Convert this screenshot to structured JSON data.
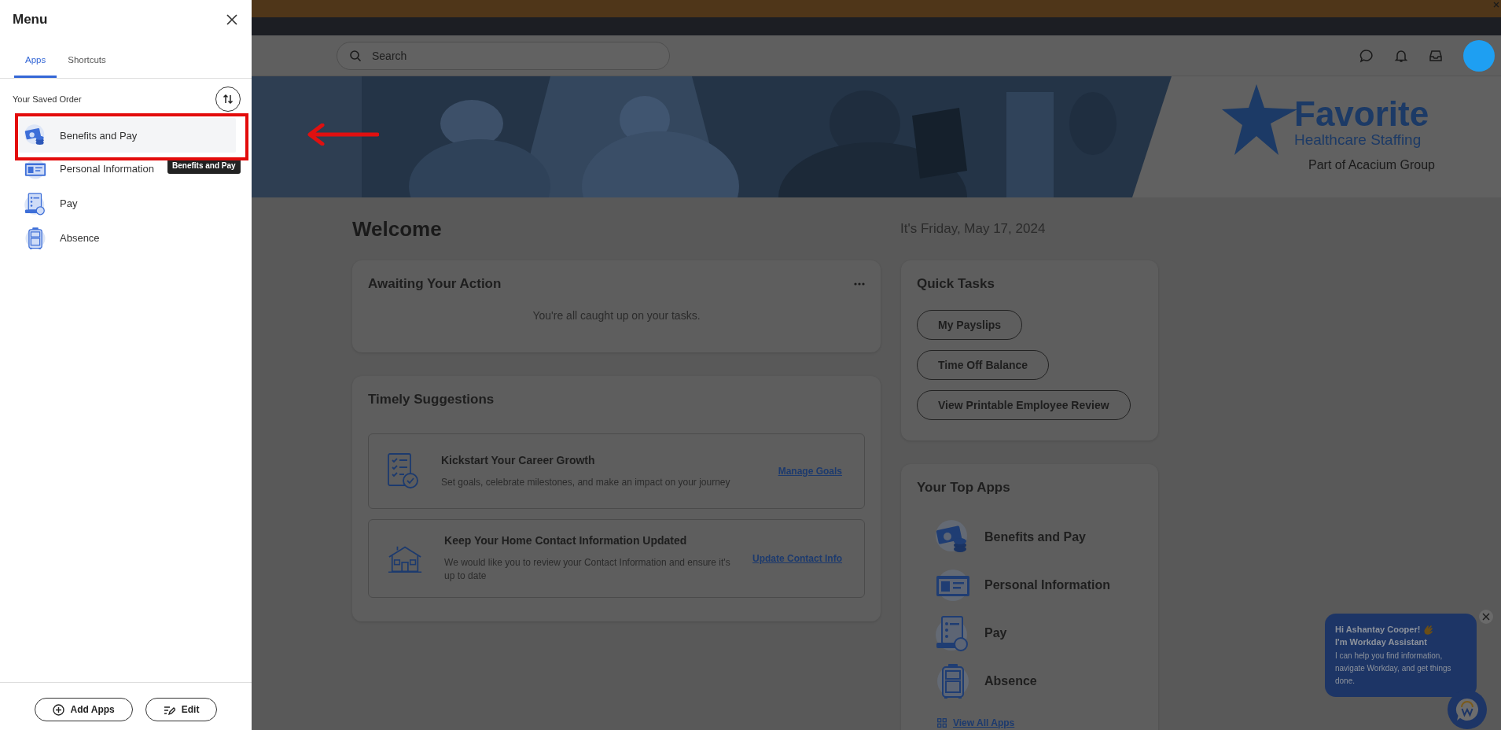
{
  "menu": {
    "title": "Menu",
    "tabs": [
      {
        "label": "Apps",
        "selected": true
      },
      {
        "label": "Shortcuts",
        "selected": false
      }
    ],
    "section_label": "Your Saved Order",
    "apps": [
      {
        "kind": "benefits",
        "label": "Benefits and Pay",
        "selected": true
      },
      {
        "kind": "personal",
        "label": "Personal Information",
        "selected": false
      },
      {
        "kind": "pay",
        "label": "Pay",
        "selected": false
      },
      {
        "kind": "absence",
        "label": "Absence",
        "selected": false
      }
    ],
    "tooltip": "Benefits and Pay",
    "buttons": [
      {
        "kind": "add",
        "label": "Add Apps"
      },
      {
        "kind": "edit",
        "label": "Edit"
      }
    ]
  },
  "header": {
    "search": {
      "placeholder": "Search"
    }
  },
  "banner": {
    "logo": {
      "name": "Favorite",
      "tagline": "Healthcare Staffing",
      "group": "Part of Acacium Group"
    }
  },
  "welcome": {
    "title": "Welcome",
    "date": "It's Friday, May 17, 2024"
  },
  "awaiting": {
    "title": "Awaiting Your Action",
    "message": "You're all caught up on your tasks."
  },
  "suggestions": {
    "title": "Timely Suggestions",
    "items": [
      {
        "kind": "goals",
        "title": "Kickstart Your Career Growth",
        "text": "Set goals, celebrate milestones, and make an impact on your journey",
        "link": "Manage Goals"
      },
      {
        "kind": "home",
        "title": "Keep Your Home Contact Information Updated",
        "text": "We would like you to review your Contact Information and ensure it's up to date",
        "link": "Update Contact Info"
      }
    ]
  },
  "quick_tasks": {
    "title": "Quick Tasks",
    "buttons": [
      "My Payslips",
      "Time Off Balance",
      "View Printable Employee Review"
    ]
  },
  "top_apps": {
    "title": "Your Top Apps",
    "apps": [
      {
        "kind": "benefits",
        "label": "Benefits and Pay"
      },
      {
        "kind": "personal",
        "label": "Personal Information"
      },
      {
        "kind": "pay",
        "label": "Pay"
      },
      {
        "kind": "absence",
        "label": "Absence"
      }
    ],
    "link": "View All Apps"
  },
  "assistant": {
    "greeting": "Hi Ashantay Cooper!",
    "name_line": "I'm Workday Assistant",
    "text": "I can help you find information, navigate Workday, and get things done."
  }
}
